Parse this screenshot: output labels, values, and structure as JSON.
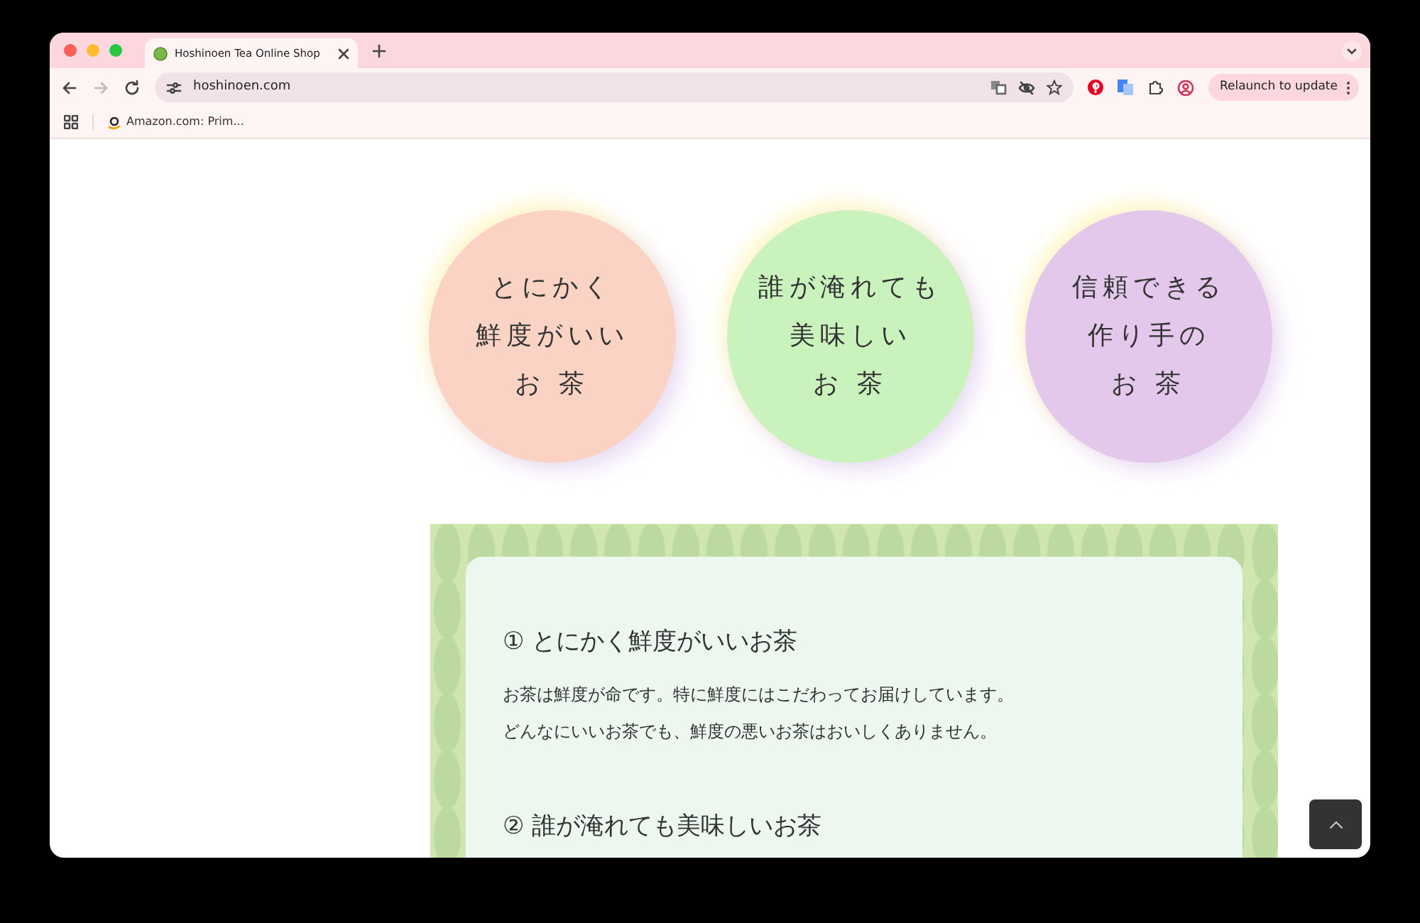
{
  "browser": {
    "tabs": [
      {
        "title": "Hoshinoen Tea Online Shop",
        "selected": true
      }
    ],
    "forward_disabled": true,
    "url": "hoshinoen.com",
    "bookmarks": [
      {
        "label": "Amazon.com: Prim..."
      }
    ],
    "update_button": "Relaunch to update"
  },
  "circles": [
    {
      "lines": [
        "とにかく",
        "鮮度がいい",
        "お 茶"
      ],
      "color": "#fbd3c4"
    },
    {
      "lines": [
        "誰が淹れても",
        "美味しい",
        "お 茶"
      ],
      "color": "#c9f2bd"
    },
    {
      "lines": [
        "信頼できる",
        "作り手の",
        "お 茶"
      ],
      "color": "#e3c8ec"
    }
  ],
  "sections": [
    {
      "heading": "① とにかく鮮度がいいお茶",
      "paragraph": [
        "お茶は鮮度が命です。特に鮮度にはこだわってお届けしています。",
        "どんなにいいお茶でも、鮮度の悪いお茶はおいしくありません。"
      ]
    },
    {
      "heading": "② 誰が淹れても美味しいお茶"
    }
  ]
}
